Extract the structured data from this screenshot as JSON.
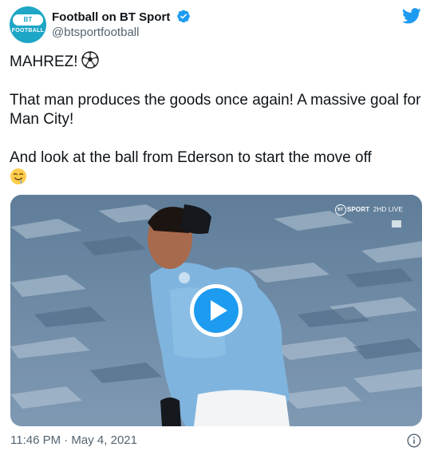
{
  "author": {
    "display_name": "Football on BT Sport",
    "handle": "@btsportfootball",
    "avatar_badge": "BT SPORT",
    "avatar_text": "FOOTBALL",
    "verified_icon": "verified-badge-icon"
  },
  "brand": {
    "icon": "twitter-bird-icon",
    "color": "#1d9bf0"
  },
  "tweet": {
    "line1": "MAHREZ!",
    "line1_emoji": "soccer-ball-icon",
    "line2": "That man produces the goods once again! A massive goal for Man City!",
    "line3": "And look at the ball from Ederson to start the move off",
    "line3_emoji": "drooling-face-icon"
  },
  "media": {
    "type": "video",
    "overlay_brand": "SPORT",
    "overlay_badge": "BT",
    "overlay_channel": "2HD LIVE",
    "play_icon": "play-icon"
  },
  "footer": {
    "timestamp": "11:46 PM · May 4, 2021",
    "info_icon": "info-icon"
  }
}
